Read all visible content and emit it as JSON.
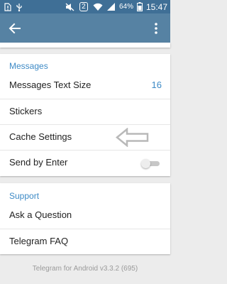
{
  "status_bar": {
    "battery_percent": "64%",
    "time": "15:47",
    "network_badge": "2",
    "icons": [
      "sim-alert-icon",
      "usb-icon",
      "mute-icon",
      "wifi-icon",
      "signal-icon",
      "battery-icon"
    ]
  },
  "app_bar": {
    "back_icon": "back-arrow-icon",
    "menu_icon": "overflow-menu-icon"
  },
  "messages_section": {
    "header": "Messages",
    "items": [
      {
        "label": "Messages Text Size",
        "value": "16"
      },
      {
        "label": "Stickers"
      },
      {
        "label": "Cache Settings"
      },
      {
        "label": "Send by Enter",
        "toggle": "off"
      }
    ]
  },
  "support_section": {
    "header": "Support",
    "items": [
      {
        "label": "Ask a Question"
      },
      {
        "label": "Telegram FAQ"
      }
    ]
  },
  "footer": {
    "version": "Telegram for Android v3.3.2 (695)"
  },
  "colors": {
    "status_bar": "#3f6f96",
    "app_bar": "#5682a3",
    "accent": "#3d8ac6",
    "background": "#ececec"
  }
}
